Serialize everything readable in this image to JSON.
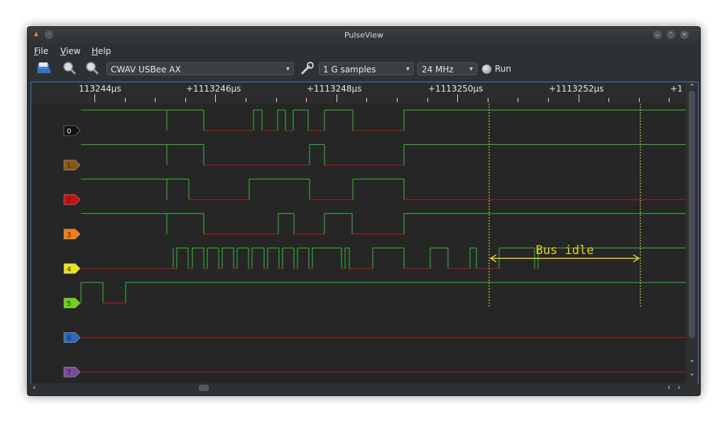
{
  "window": {
    "title": "PulseView"
  },
  "menu": [
    {
      "label": "File"
    },
    {
      "label": "View"
    },
    {
      "label": "Help"
    }
  ],
  "toolbar": {
    "device": "CWAV USBee AX",
    "samples": "1 G samples",
    "samplerate": "24 MHz",
    "run_label": "Run"
  },
  "ruler": {
    "labels": [
      "113244µs",
      "+1113246µs",
      "+1113248µs",
      "+1113250µs",
      "+1113252µs",
      "+1"
    ]
  },
  "channels": [
    {
      "label": "0",
      "color": "#111111",
      "text_color": "#ffffff"
    },
    {
      "label": "1",
      "color": "#8b5a12",
      "text_color": "#222222"
    },
    {
      "label": "2",
      "color": "#cc1010",
      "text_color": "#222222"
    },
    {
      "label": "3",
      "color": "#f57f0e",
      "text_color": "#222222"
    },
    {
      "label": "4",
      "color": "#ece418",
      "text_color": "#222222"
    },
    {
      "label": "5",
      "color": "#6fd414",
      "text_color": "#222222"
    },
    {
      "label": "6",
      "color": "#2d68c1",
      "text_color": "#222222"
    },
    {
      "label": "7",
      "color": "#7d4a9a",
      "text_color": "#222222"
    }
  ],
  "annotation": {
    "label": "Bus idle",
    "color": "#e8d020"
  },
  "colors": {
    "trace_high": "#33c233",
    "trace_low": "#c0191b",
    "cursor": "#f0e442",
    "selection_border": "#3b78c2"
  }
}
